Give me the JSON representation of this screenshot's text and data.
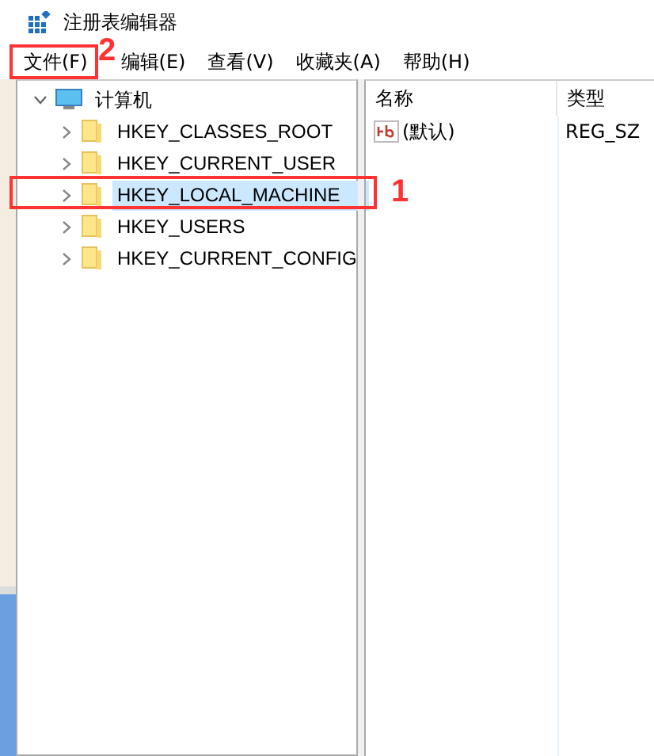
{
  "window": {
    "title": "注册表编辑器"
  },
  "menu": [
    {
      "label": "文件(F)"
    },
    {
      "label": "编辑(E)"
    },
    {
      "label": "查看(V)"
    },
    {
      "label": "收藏夹(A)"
    },
    {
      "label": "帮助(H)"
    }
  ],
  "tree": {
    "label": "计算机",
    "expanded": true,
    "children": [
      {
        "label": "HKEY_CLASSES_ROOT",
        "selected": false
      },
      {
        "label": "HKEY_CURRENT_USER",
        "selected": false
      },
      {
        "label": "HKEY_LOCAL_MACHINE",
        "selected": true
      },
      {
        "label": "HKEY_USERS",
        "selected": false
      },
      {
        "label": "HKEY_CURRENT_CONFIG",
        "selected": false
      }
    ]
  },
  "list": {
    "columns": [
      "名称",
      "类型"
    ],
    "rows": [
      {
        "name": "(默认)",
        "type": "REG_SZ"
      }
    ]
  },
  "annotations": [
    {
      "number": "1"
    },
    {
      "number": "2"
    }
  ]
}
